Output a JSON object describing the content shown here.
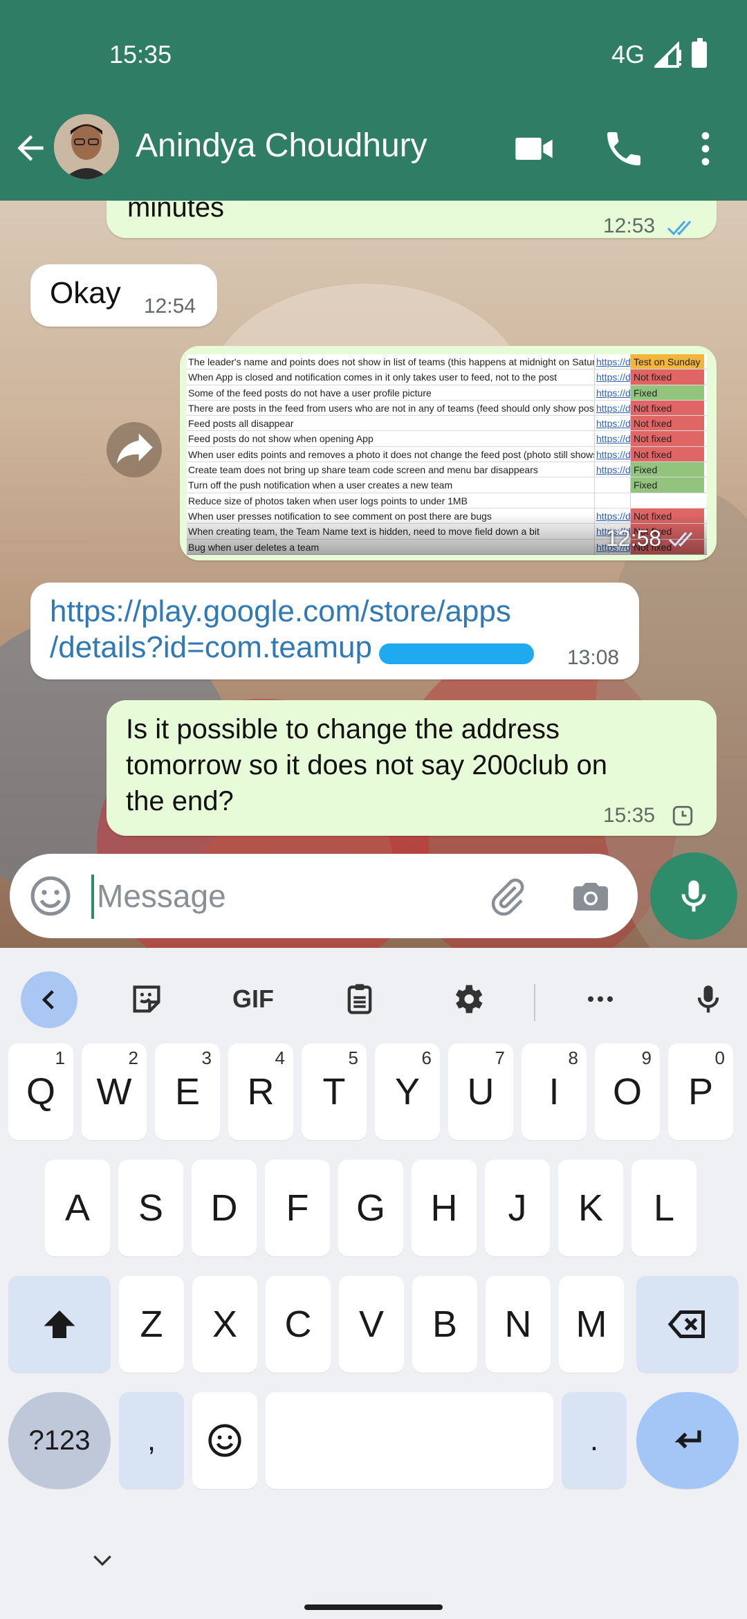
{
  "status_bar": {
    "time": "15:35",
    "network": "4G"
  },
  "header": {
    "contact_name": "Anindya Choudhury",
    "icons": [
      "back-arrow-icon",
      "video-call-icon",
      "voice-call-icon",
      "more-vert-icon"
    ],
    "color": "#2e7d64"
  },
  "messages": [
    {
      "direction": "out",
      "text": "minutes",
      "time": "12:53",
      "status": "read"
    },
    {
      "direction": "in",
      "text": "Okay",
      "time": "12:54"
    },
    {
      "direction": "out",
      "type": "image",
      "time": "12:58",
      "status": "read",
      "spreadsheet": [
        {
          "desc": "The leader's name and points does not show in list of teams (this happens at midnight on Saturday)",
          "link": "https://d",
          "status": "Test on Sunday",
          "color": "#f4b63a"
        },
        {
          "desc": "When App is closed and notification comes in it only takes user to feed, not to the post",
          "link": "https://d",
          "status": "Not fixed",
          "color": "#e06666"
        },
        {
          "desc": "Some of the feed posts do not have a user profile picture",
          "link": "https://d",
          "status": "Fixed",
          "color": "#93c47d"
        },
        {
          "desc": "There are posts in the feed from users who are not in any of teams (feed should only show posts)",
          "link": "https://d",
          "status": "Not fixed",
          "color": "#e06666"
        },
        {
          "desc": "Feed posts all disappear",
          "link": "https://d",
          "status": "Not fixed",
          "color": "#e06666"
        },
        {
          "desc": "Feed posts do not show when opening App",
          "link": "https://d",
          "status": "Not fixed",
          "color": "#e06666"
        },
        {
          "desc": "When user edits points and removes a photo it does not change the feed post (photo still shows)",
          "link": "https://d",
          "status": "Not fixed",
          "color": "#e06666"
        },
        {
          "desc": "Create team does not bring up share team code screen and menu bar disappears",
          "link": "https://d",
          "status": "Fixed",
          "color": "#93c47d"
        },
        {
          "desc": "Turn off the push notification when a user creates a new team",
          "link": "",
          "status": "Fixed",
          "color": "#93c47d"
        },
        {
          "desc": "Reduce size of photos taken when user logs points to under 1MB",
          "link": "",
          "status": "",
          "color": "#ffffff"
        },
        {
          "desc": "When user presses notification to see comment on post there are bugs",
          "link": "https://d",
          "status": "Not fixed",
          "color": "#e06666"
        },
        {
          "desc": "When creating team, the Team Name text is hidden, need to move field down a bit",
          "link": "https://d",
          "status": "Not fixed",
          "color": "#e06666"
        },
        {
          "desc": "Bug when user deletes a team",
          "link": "https://d",
          "status": "Not fixed",
          "color": "#e06666"
        }
      ]
    },
    {
      "direction": "in",
      "type": "link",
      "text_line1": "https://play.google.com/store/apps",
      "text_line2": "/details?id=com.teamup",
      "time": "13:08"
    },
    {
      "direction": "out",
      "text_lines": [
        "Is it possible to change the address",
        "tomorrow so it does not say 200club on",
        "the end?"
      ],
      "time": "15:35",
      "status": "pending"
    }
  ],
  "input": {
    "placeholder": "Message"
  },
  "keyboard": {
    "toolbar": [
      "collapse-icon",
      "sticker-icon",
      "GIF",
      "clipboard-icon",
      "settings-icon",
      "more-horiz-icon",
      "voice-input-icon"
    ],
    "row1": [
      {
        "key": "Q",
        "hint": "1"
      },
      {
        "key": "W",
        "hint": "2"
      },
      {
        "key": "E",
        "hint": "3"
      },
      {
        "key": "R",
        "hint": "4"
      },
      {
        "key": "T",
        "hint": "5"
      },
      {
        "key": "Y",
        "hint": "6"
      },
      {
        "key": "U",
        "hint": "7"
      },
      {
        "key": "I",
        "hint": "8"
      },
      {
        "key": "O",
        "hint": "9"
      },
      {
        "key": "P",
        "hint": "0"
      }
    ],
    "row2": [
      "A",
      "S",
      "D",
      "F",
      "G",
      "H",
      "J",
      "K",
      "L"
    ],
    "row3": [
      "Z",
      "X",
      "C",
      "V",
      "B",
      "N",
      "M"
    ],
    "symbols_key": "?123",
    "comma_key": ",",
    "period_key": "."
  }
}
